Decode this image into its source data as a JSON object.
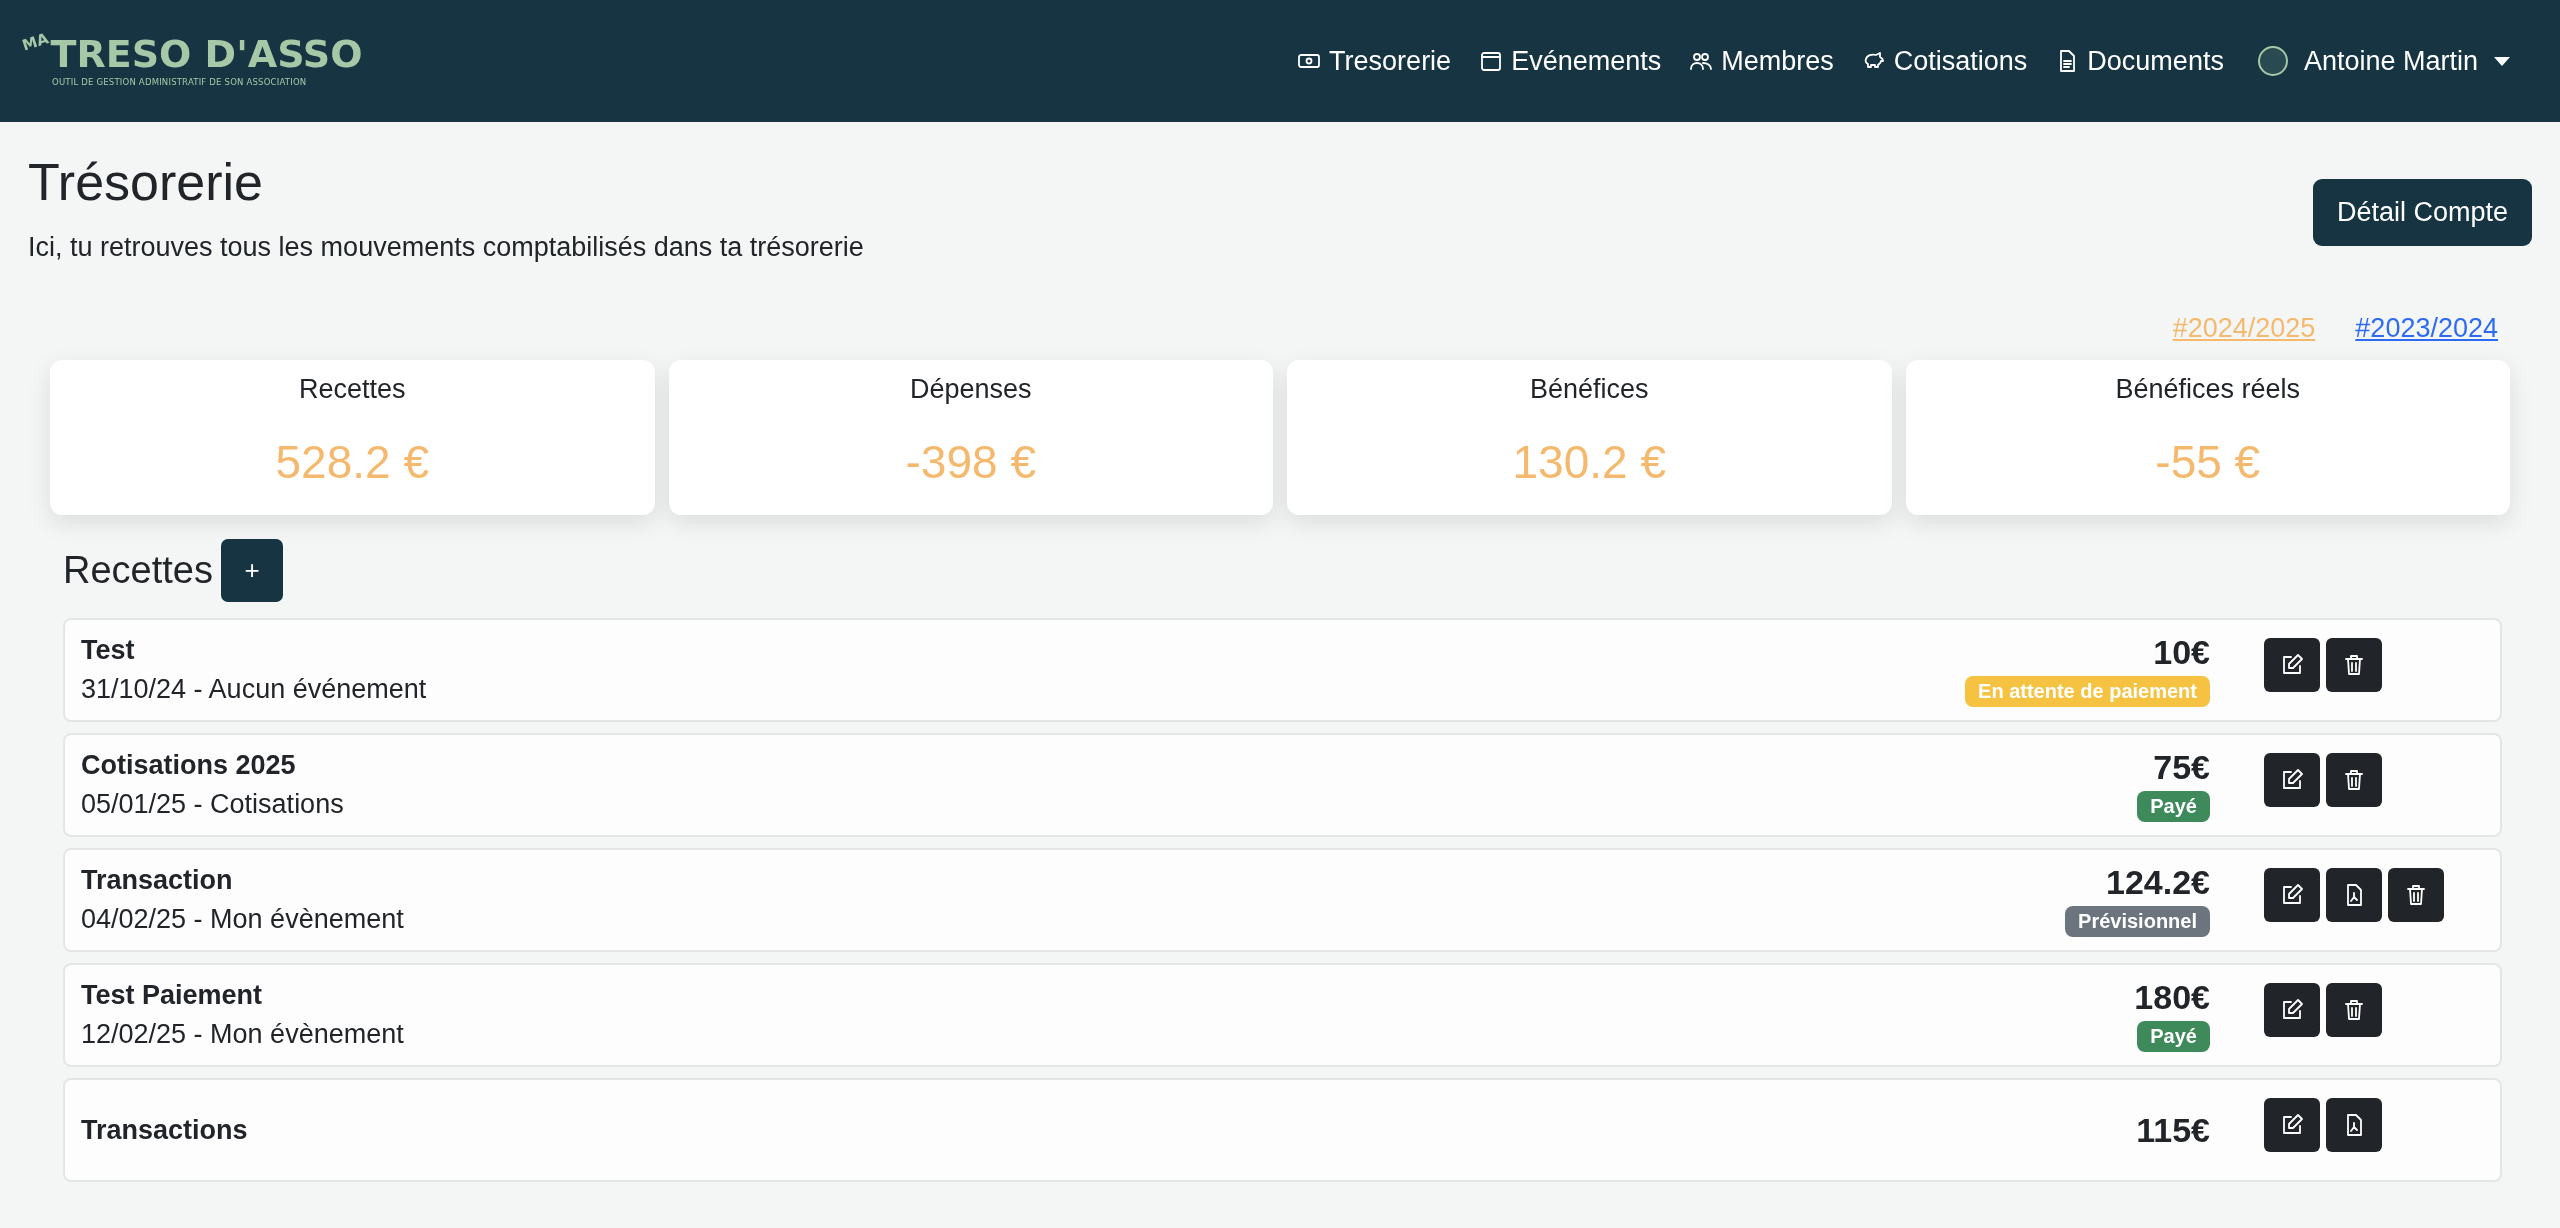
{
  "navbar": {
    "logo": {
      "prefix": "MA",
      "name": "TRESO D'ASSO",
      "tagline": "OUTIL DE GESTION ADMINISTRATIF DE SON ASSOCIATION"
    },
    "items": [
      {
        "kind": "money",
        "label": "Tresorerie"
      },
      {
        "kind": "calendar",
        "label": "Evénements"
      },
      {
        "kind": "people",
        "label": "Membres"
      },
      {
        "kind": "piggy",
        "label": "Cotisations"
      },
      {
        "kind": "document",
        "label": "Documents"
      }
    ],
    "user": {
      "name": "Antoine Martin"
    }
  },
  "header": {
    "title": "Trésorerie",
    "subtitle": "Ici, tu retrouves tous les mouvements comptabilisés dans ta trésorerie",
    "button": "Détail Compte"
  },
  "years": [
    {
      "label": "#2024/2025",
      "selected": true
    },
    {
      "label": "#2023/2024",
      "selected": false
    }
  ],
  "stats": [
    {
      "label": "Recettes",
      "value": "528.2 €"
    },
    {
      "label": "Dépenses",
      "value": "-398 €"
    },
    {
      "label": "Bénéfices",
      "value": "130.2 €"
    },
    {
      "label": "Bénéfices réels",
      "value": "-55 €"
    }
  ],
  "section": {
    "title": "Recettes",
    "add_button": "+"
  },
  "rows": [
    {
      "title": "Test",
      "subtitle": "31/10/24 - Aucun événement",
      "amount": "10€",
      "status": {
        "kind": "pending",
        "label": "En attente de paiement"
      },
      "actions": [
        {
          "kind": "edit"
        },
        {
          "kind": "delete"
        }
      ]
    },
    {
      "title": "Cotisations 2025",
      "subtitle": "05/01/25 - Cotisations",
      "amount": "75€",
      "status": {
        "kind": "paid",
        "label": "Payé"
      },
      "actions": [
        {
          "kind": "edit"
        },
        {
          "kind": "delete"
        }
      ]
    },
    {
      "title": "Transaction",
      "subtitle": "04/02/25 - Mon évènement",
      "amount": "124.2€",
      "status": {
        "kind": "forecast",
        "label": "Prévisionnel"
      },
      "actions": [
        {
          "kind": "edit"
        },
        {
          "kind": "pdf"
        },
        {
          "kind": "delete"
        }
      ]
    },
    {
      "title": "Test Paiement",
      "subtitle": "12/02/25 - Mon évènement",
      "amount": "180€",
      "status": {
        "kind": "paid",
        "label": "Payé"
      },
      "actions": [
        {
          "kind": "edit"
        },
        {
          "kind": "delete"
        }
      ]
    },
    {
      "title": "Transactions",
      "amount": "115€",
      "actions": [
        {
          "kind": "edit"
        },
        {
          "kind": "pdf"
        }
      ]
    }
  ]
}
